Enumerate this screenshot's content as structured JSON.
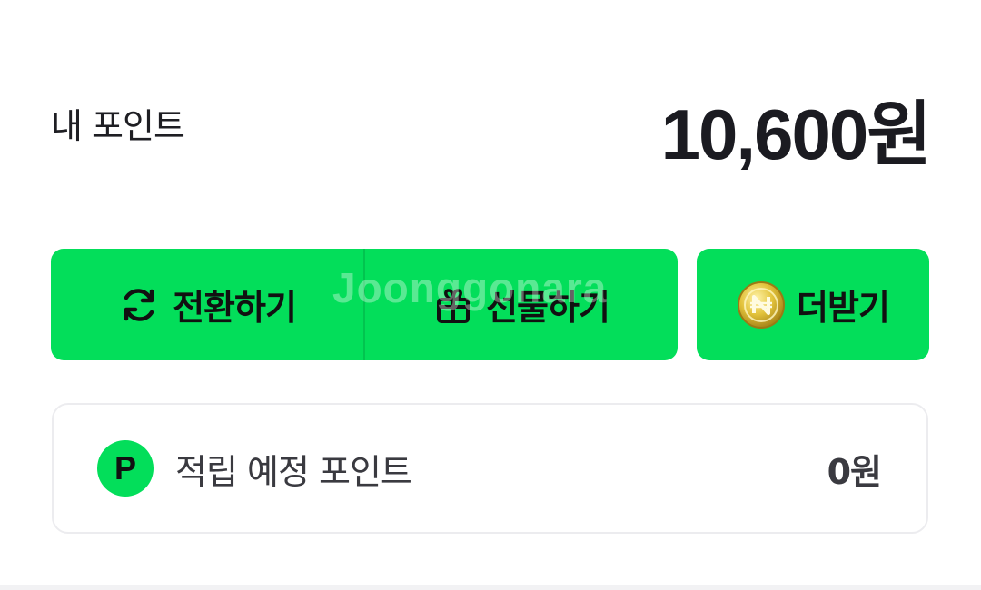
{
  "points": {
    "label": "내 포인트",
    "value": "10,600원"
  },
  "actions": {
    "convert_label": "전환하기",
    "convert_icon": "refresh-icon",
    "gift_label": "선물하기",
    "gift_icon": "gift-icon",
    "earn_more_label": "더받기",
    "earn_more_icon": "coin-icon"
  },
  "pending": {
    "badge": "P",
    "label": "적립 예정 포인트",
    "value": "0원"
  },
  "watermark": "Joonggonara",
  "colors": {
    "accent_green": "#03de5a",
    "text_dark": "#1b1b21",
    "coin_gold": "#d9b52a"
  }
}
